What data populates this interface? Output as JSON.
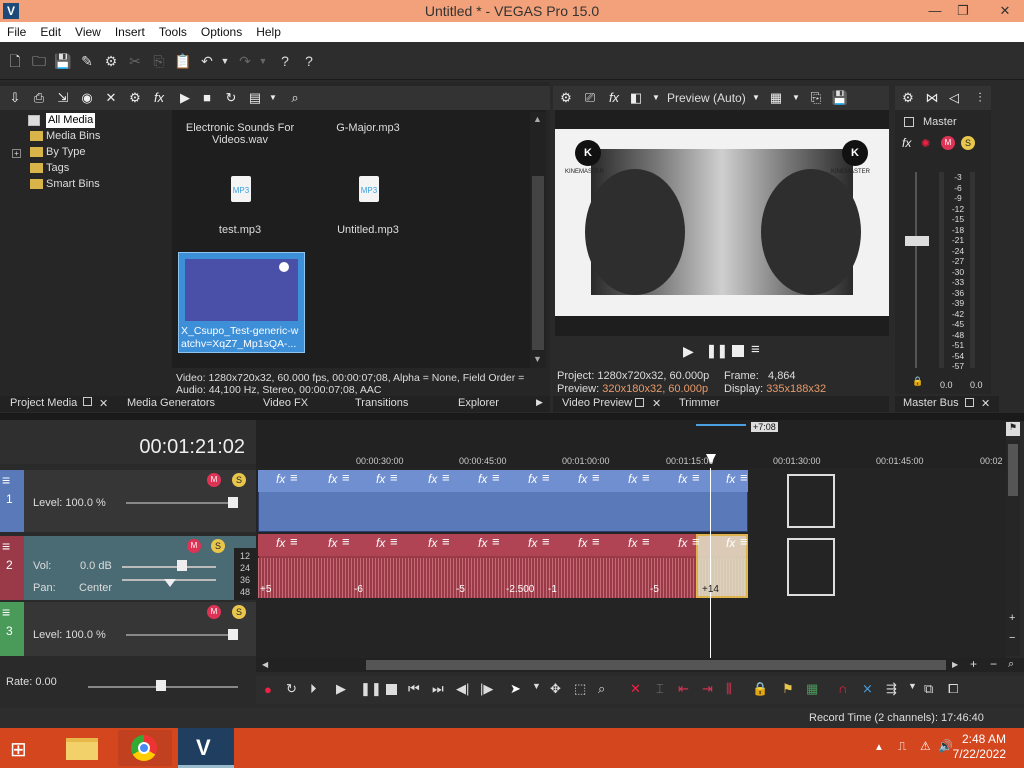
{
  "title": "Untitled * - VEGAS Pro 15.0",
  "menu": [
    "File",
    "Edit",
    "View",
    "Insert",
    "Tools",
    "Options",
    "Help"
  ],
  "project_media": {
    "tree": [
      "All Media",
      "Media Bins",
      "By Type",
      "Tags",
      "Smart Bins"
    ],
    "files": [
      "Electronic Sounds For Videos.wav",
      "G-Major.mp3",
      "test.mp3",
      "Untitled.mp3",
      "X_Csupo_Test-generic-watchv=XqZ7_Mp1sQA-..."
    ],
    "info_line1": "Video: 1280x720x32, 60.000 fps, 00:00:07;08, Alpha = None, Field Order =",
    "info_line2": "Audio: 44,100 Hz, Stereo, 00:00:07;08, AAC"
  },
  "tabs_left": [
    "Project Media",
    "Media Generators",
    "Video FX",
    "Transitions",
    "Explorer"
  ],
  "preview": {
    "mode": "Preview (Auto)",
    "project_label": "Project:",
    "project_value": "1280x720x32, 60.000p",
    "frame_label": "Frame:",
    "frame_value": "4,864",
    "preview_label": "Preview:",
    "preview_value": "320x180x32, 60.000p",
    "display_label": "Display:",
    "display_value": "335x188x32",
    "logo_text": "KINEMASTER"
  },
  "tabs_mid": [
    "Video Preview",
    "Trimmer"
  ],
  "master": {
    "label": "Master",
    "scale": [
      "3",
      "6",
      "9",
      "12",
      "15",
      "18",
      "21",
      "24",
      "27",
      "30",
      "33",
      "36",
      "39",
      "42",
      "45",
      "48",
      "51",
      "54",
      "57"
    ],
    "left_val": "0.0",
    "right_val": "0.0",
    "tab": "Master Bus"
  },
  "timeline": {
    "timecode": "00:01:21:02",
    "ruler": [
      "00:00:30:00",
      "00:00:45:00",
      "00:01:00:00",
      "00:01:15:00",
      "00:01:30:00",
      "00:01:45:00",
      "00:02"
    ],
    "marker": "+7:08",
    "track1_level": "Level: 100.0 %",
    "track2_vol_label": "Vol:",
    "track2_vol_value": "0.0 dB",
    "track2_pan_label": "Pan:",
    "track2_pan_value": "Center",
    "track3_level": "Level: 100.0 %",
    "meter_labels": [
      "12",
      "24",
      "36",
      "48"
    ],
    "audio_labels": [
      "+5",
      "-6",
      "-5",
      "-2.500",
      "-1",
      "-5",
      "+14"
    ],
    "rate": "Rate: 0.00",
    "record_time": "Record Time (2 channels): 17:46:40"
  },
  "taskbar": {
    "time": "2:48 AM",
    "date": "7/22/2022"
  },
  "colors": {
    "title_bg": "#f2a17a",
    "taskbar": "#d4461e",
    "video_track": "#5a79b8",
    "audio_track": "#9a3a48"
  }
}
